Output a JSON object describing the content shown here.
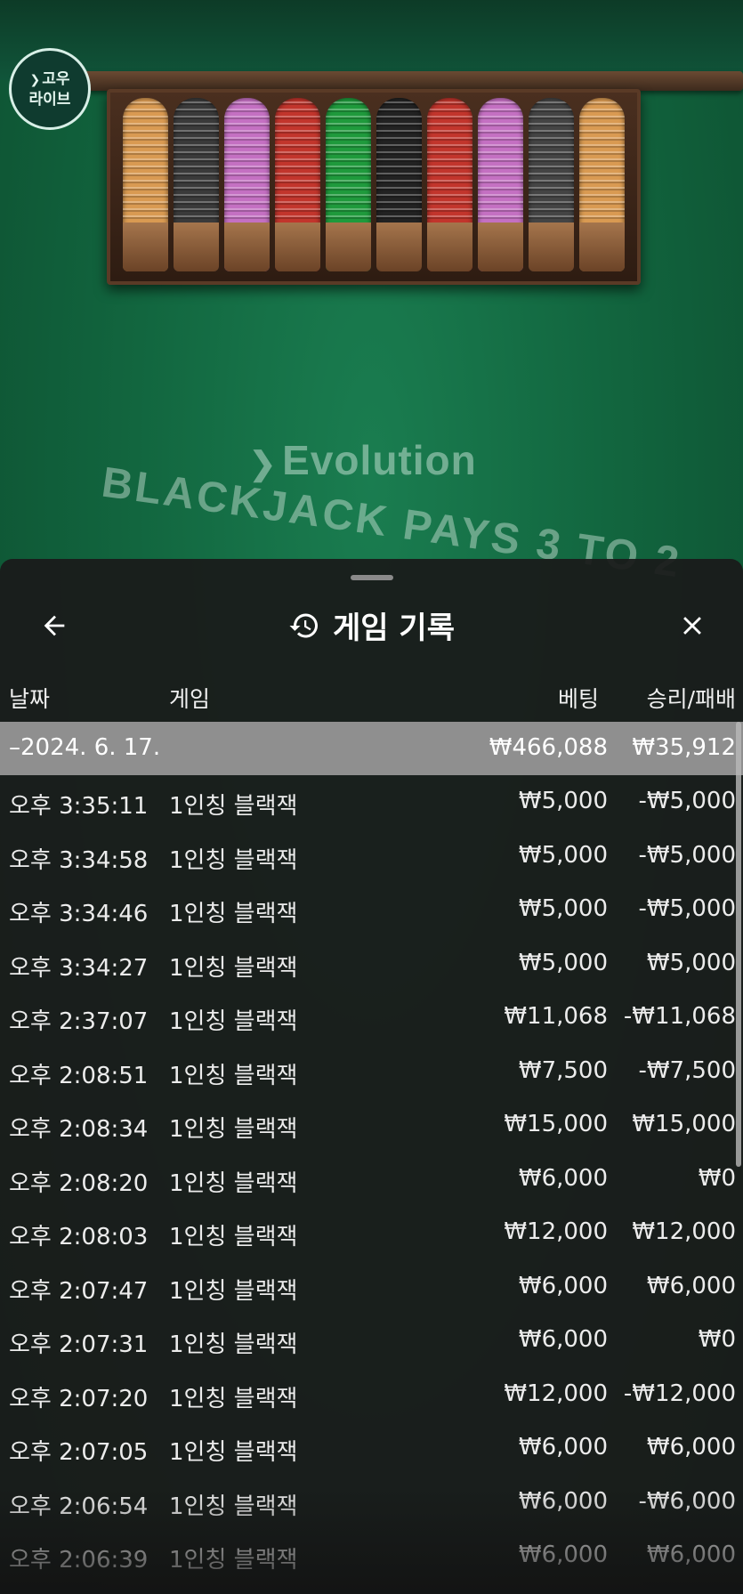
{
  "table": {
    "badge_line1": "고우",
    "badge_line2": "라이브",
    "brand": "Evolution",
    "felt_text": "BLACKJACK PAYS 3 TO 2",
    "chip_colors": [
      "#d99a52",
      "#3a3a3a",
      "#c470c2",
      "#c2352c",
      "#1f9a3c",
      "#222222",
      "#c2352c",
      "#c470c2",
      "#444444",
      "#d99a52"
    ]
  },
  "panel": {
    "title": "게임 기록",
    "back_icon": "arrow-left-icon",
    "history_icon": "history-icon",
    "close_icon": "close-icon",
    "columns": {
      "date": "날짜",
      "game": "게임",
      "bet": "베팅",
      "result": "승리/패배"
    },
    "summary": {
      "date": "–2024. 6. 17.",
      "bet": "₩466,088",
      "result": "₩35,912"
    },
    "rows": [
      {
        "time": "오후 3:35:11",
        "game": "1인칭 블랙잭",
        "bet": "₩5,000",
        "result": "-₩5,000"
      },
      {
        "time": "오후 3:34:58",
        "game": "1인칭 블랙잭",
        "bet": "₩5,000",
        "result": "-₩5,000"
      },
      {
        "time": "오후 3:34:46",
        "game": "1인칭 블랙잭",
        "bet": "₩5,000",
        "result": "-₩5,000"
      },
      {
        "time": "오후 3:34:27",
        "game": "1인칭 블랙잭",
        "bet": "₩5,000",
        "result": "₩5,000"
      },
      {
        "time": "오후 2:37:07",
        "game": "1인칭 블랙잭",
        "bet": "₩11,068",
        "result": "-₩11,068"
      },
      {
        "time": "오후 2:08:51",
        "game": "1인칭 블랙잭",
        "bet": "₩7,500",
        "result": "-₩7,500"
      },
      {
        "time": "오후 2:08:34",
        "game": "1인칭 블랙잭",
        "bet": "₩15,000",
        "result": "₩15,000"
      },
      {
        "time": "오후 2:08:20",
        "game": "1인칭 블랙잭",
        "bet": "₩6,000",
        "result": "₩0"
      },
      {
        "time": "오후 2:08:03",
        "game": "1인칭 블랙잭",
        "bet": "₩12,000",
        "result": "₩12,000"
      },
      {
        "time": "오후 2:07:47",
        "game": "1인칭 블랙잭",
        "bet": "₩6,000",
        "result": "₩6,000"
      },
      {
        "time": "오후 2:07:31",
        "game": "1인칭 블랙잭",
        "bet": "₩6,000",
        "result": "₩0"
      },
      {
        "time": "오후 2:07:20",
        "game": "1인칭 블랙잭",
        "bet": "₩12,000",
        "result": "-₩12,000"
      },
      {
        "time": "오후 2:07:05",
        "game": "1인칭 블랙잭",
        "bet": "₩6,000",
        "result": "₩6,000"
      },
      {
        "time": "오후 2:06:54",
        "game": "1인칭 블랙잭",
        "bet": "₩6,000",
        "result": "-₩6,000"
      },
      {
        "time": "오후 2:06:39",
        "game": "1인칭 블랙잭",
        "bet": "₩6,000",
        "result": "₩6,000"
      }
    ]
  }
}
